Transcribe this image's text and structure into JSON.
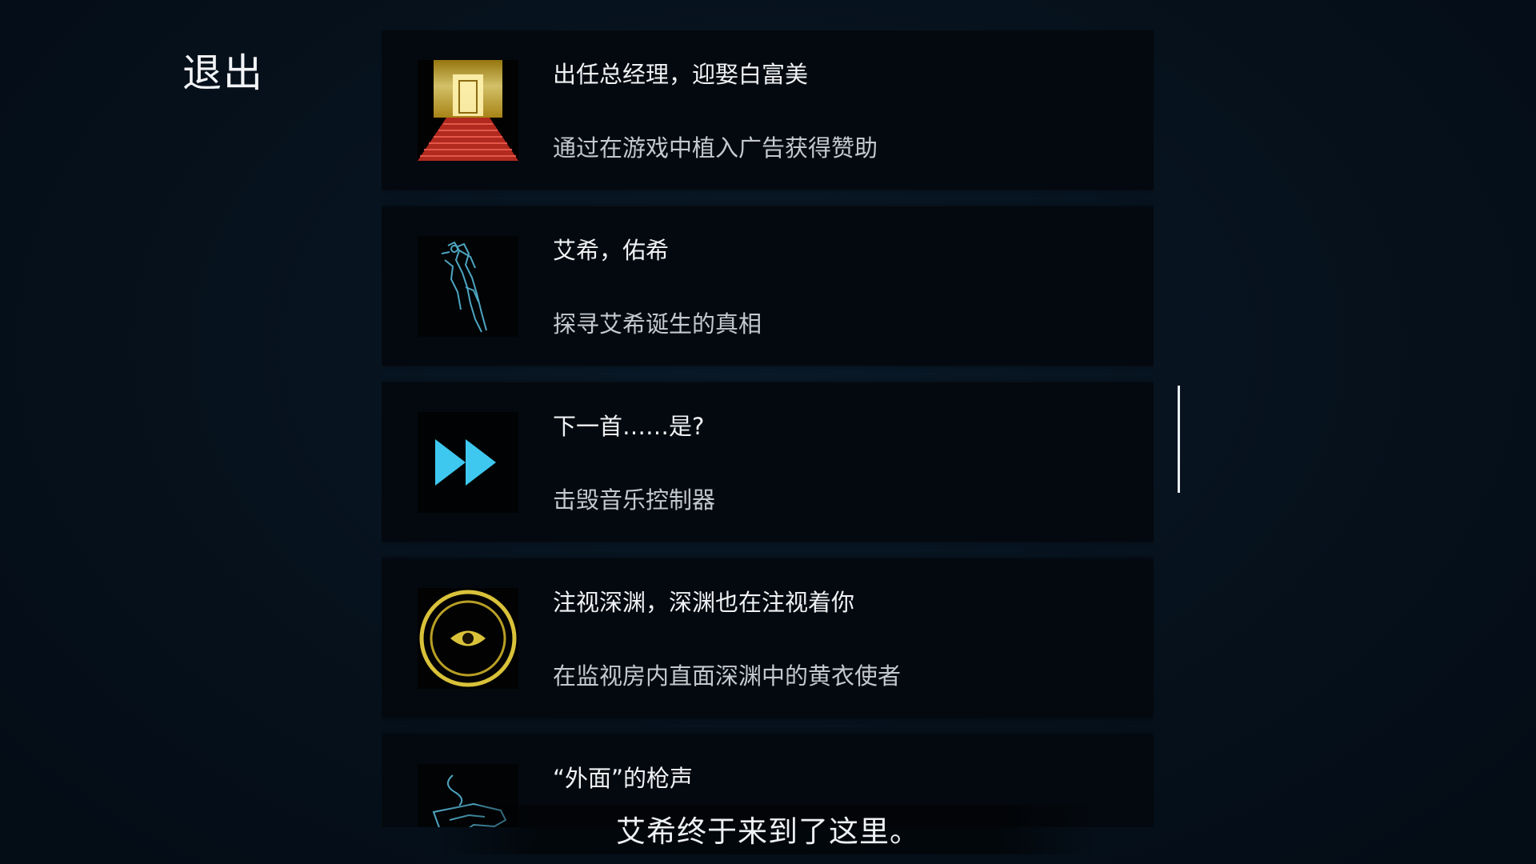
{
  "header": {
    "exit_label": "退出"
  },
  "achievements": [
    {
      "icon": "red-carpet-golden-door-icon",
      "title": "出任总经理，迎娶白富美",
      "description": "通过在游戏中植入广告获得赞助"
    },
    {
      "icon": "blue-wire-robot-arm-icon",
      "title": "艾希，佑希",
      "description": "探寻艾希诞生的真相"
    },
    {
      "icon": "fast-forward-icon",
      "title": "下一首……是?",
      "description": "击毁音乐控制器"
    },
    {
      "icon": "golden-eye-circle-icon",
      "title": "注视深渊，深渊也在注视着你",
      "description": "在监视房内直面深渊中的黄衣使者"
    },
    {
      "icon": "blue-hand-pistol-icon",
      "title": "“外面”的枪声",
      "description": ""
    }
  ],
  "subtitle": "艾希终于来到了这里。",
  "colors": {
    "background": "#06111c",
    "card": "#04090f",
    "accent_cyan": "#39c6ee",
    "accent_gold": "#d9c23a",
    "carpet_red": "#c8392b"
  }
}
